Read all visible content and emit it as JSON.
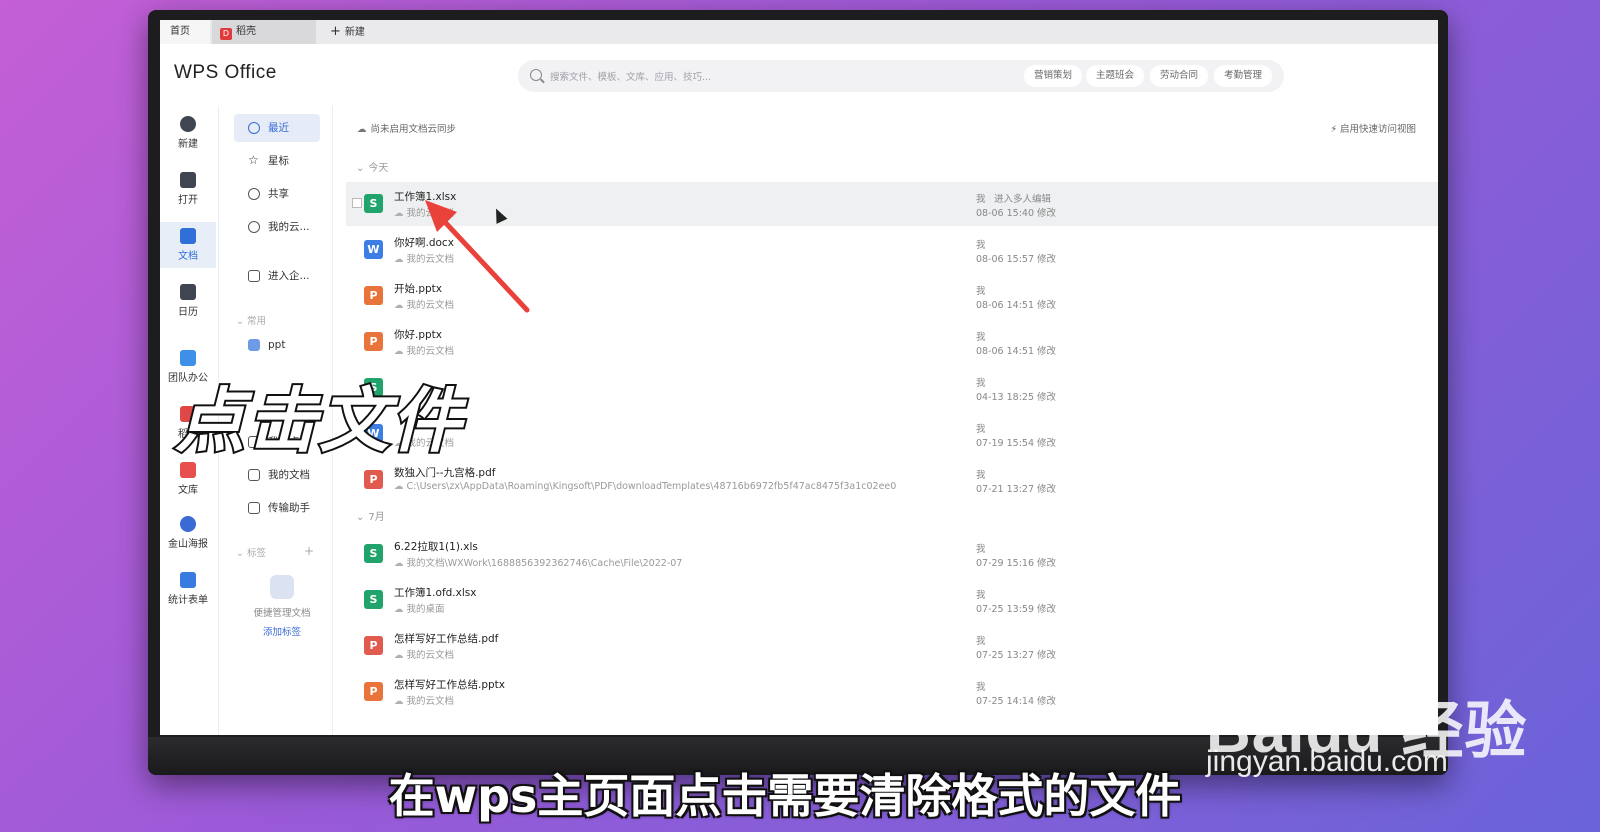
{
  "tabs": {
    "home": "首页",
    "daoke": "稻壳",
    "new": "新建"
  },
  "app_title": "WPS Office",
  "search": {
    "placeholder": "搜索文件、模板、文库、应用、技巧...",
    "tags": [
      "营销策划",
      "主题班会",
      "劳动合同",
      "考勤管理"
    ]
  },
  "left_rail": [
    {
      "label": "新建",
      "icon": "plus-circle-icon"
    },
    {
      "label": "打开",
      "icon": "folder-icon"
    },
    {
      "label": "文档",
      "icon": "document-icon"
    },
    {
      "label": "日历",
      "icon": "calendar-icon"
    },
    {
      "label": "团队办公",
      "icon": "team-icon"
    },
    {
      "label": "稻壳",
      "icon": "daoke-icon"
    },
    {
      "label": "文库",
      "icon": "library-icon"
    },
    {
      "label": "金山海报",
      "icon": "poster-icon"
    },
    {
      "label": "统计表单",
      "icon": "form-icon"
    }
  ],
  "sidebar": {
    "items": [
      {
        "label": "最近",
        "icon": "clock-icon"
      },
      {
        "label": "星标",
        "icon": "star-icon"
      },
      {
        "label": "共享",
        "icon": "share-icon"
      },
      {
        "label": "我的云...",
        "icon": "cloud-icon"
      },
      {
        "label": "进入企...",
        "icon": "building-icon"
      }
    ],
    "common_header": "常用",
    "common_items": [
      {
        "label": "ppt",
        "icon": "folder-icon"
      },
      {
        "label": "我的桌面",
        "icon": "desktop-icon"
      },
      {
        "label": "我的文档",
        "icon": "mydocs-icon"
      },
      {
        "label": "传输助手",
        "icon": "transfer-icon"
      }
    ],
    "tags_header": "标签",
    "tags_hint": "便捷管理文档",
    "tags_link": "添加标签"
  },
  "main": {
    "sync_text": "尚未启用文档云同步",
    "quick_view": "启用快速访问视图",
    "groups": [
      {
        "title": "今天",
        "files": [
          {
            "name": "工作簿1.xlsx",
            "location": "我的云文档",
            "type": "s",
            "owner": "我",
            "extra": "进入多人编辑",
            "modified": "08-06 15:40 修改"
          },
          {
            "name": "你好啊.docx",
            "location": "我的云文档",
            "type": "w",
            "owner": "我",
            "modified": "08-06 15:57 修改"
          },
          {
            "name": "开始.pptx",
            "location": "我的云文档",
            "type": "p",
            "owner": "我",
            "modified": "08-06 14:51 修改"
          },
          {
            "name": "你好.pptx",
            "location": "我的云文档",
            "type": "p",
            "owner": "我",
            "modified": "08-06 14:51 修改"
          },
          {
            "name": "",
            "location": "",
            "type": "s",
            "owner": "我",
            "modified": "04-13 18:25 修改"
          },
          {
            "name": "",
            "location": "我的云文档",
            "type": "w",
            "owner": "我",
            "modified": "07-19 15:54 修改"
          },
          {
            "name": "数独入门--九宫格.pdf",
            "location": "C:\\Users\\zx\\AppData\\Roaming\\Kingsoft\\PDF\\downloadTemplates\\48716b6972fb5f47ac8475f3a1c02ee0",
            "type": "pdf",
            "owner": "我",
            "modified": "07-21 13:27 修改"
          }
        ]
      },
      {
        "title": "7月",
        "files": [
          {
            "name": "6.22拉取1(1).xls",
            "location": "我的文档\\WXWork\\1688856392362746\\Cache\\File\\2022-07",
            "type": "s",
            "owner": "我",
            "modified": "07-29 15:16 修改"
          },
          {
            "name": "工作簿1.ofd.xlsx",
            "location": "我的桌面",
            "type": "s",
            "owner": "我",
            "modified": "07-25 13:59 修改"
          },
          {
            "name": "怎样写好工作总结.pdf",
            "location": "我的云文档",
            "type": "pdf",
            "owner": "我",
            "modified": "07-25 13:27 修改"
          },
          {
            "name": "怎样写好工作总结.pptx",
            "location": "我的云文档",
            "type": "p",
            "owner": "我",
            "modified": "07-25 14:14 修改"
          }
        ]
      }
    ]
  },
  "overlay": {
    "big_caption": "点击文件",
    "subtitle": "在wps主页面点击需要清除格式的文件",
    "watermark_main": "Baidu 经验",
    "watermark_sub": "jingyan.baidu.com"
  },
  "colors": {
    "accent": "#3a6bd4",
    "arrow": "#e8423a",
    "excel": "#20a46b",
    "word": "#3d7ee4",
    "ppt": "#e8743b",
    "pdf": "#e05a4e"
  }
}
